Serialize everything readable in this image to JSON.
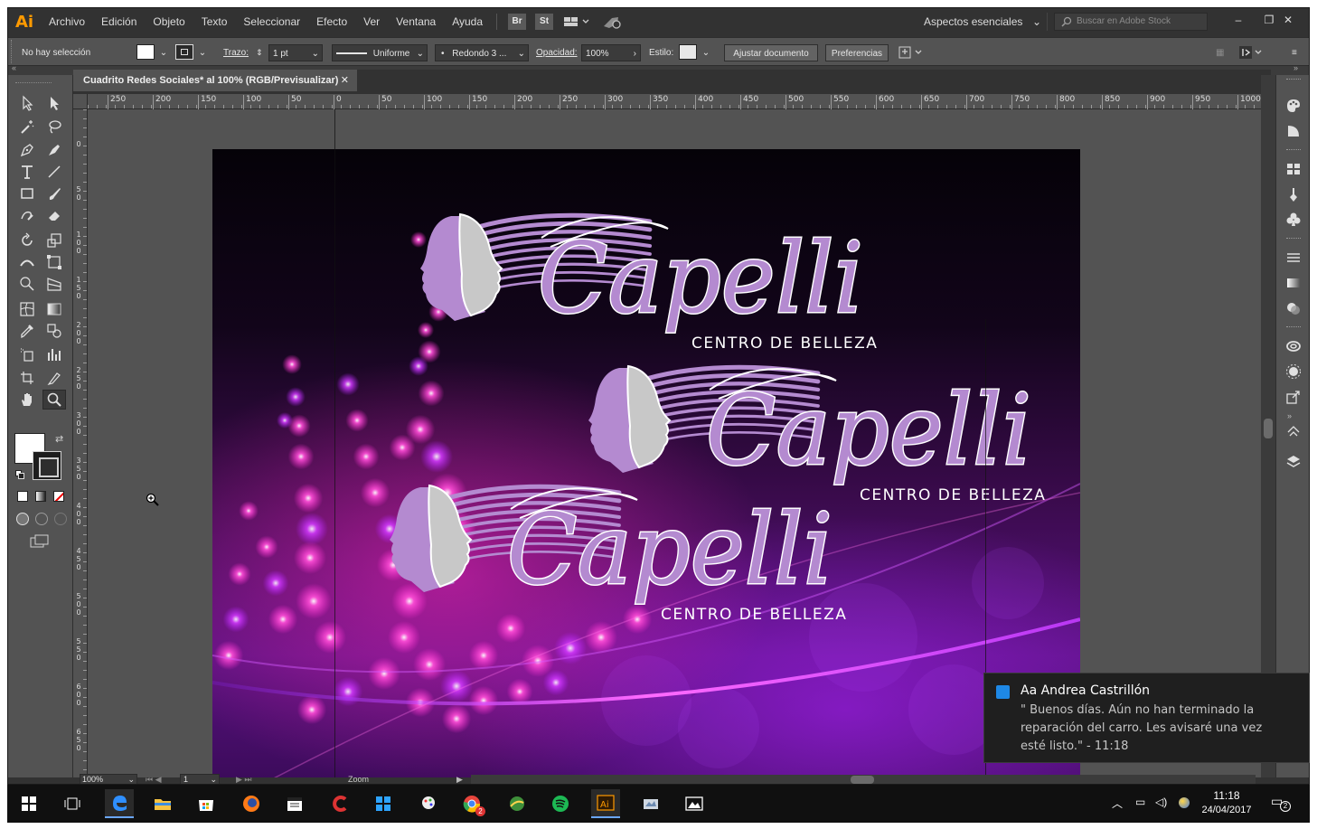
{
  "app": {
    "logo_text": "Ai",
    "menu": [
      "Archivo",
      "Edición",
      "Objeto",
      "Texto",
      "Seleccionar",
      "Efecto",
      "Ver",
      "Ventana",
      "Ayuda"
    ],
    "bridge_label": "Br",
    "stock_label": "St",
    "workspace": "Aspectos esenciales",
    "stock_search_placeholder": "Buscar en Adobe Stock",
    "window_controls": [
      "–",
      "❐",
      "✕"
    ]
  },
  "control_bar": {
    "selection_status": "No hay selección",
    "stroke_label": "Trazo:",
    "stroke_weight": "1 pt",
    "stroke_profile": "Uniforme",
    "brush_label": "Redondo 3 ...",
    "opacity_label": "Opacidad:",
    "opacity_value": "100%",
    "style_label": "Estilo:",
    "fit_button": "Ajustar documento",
    "prefs_button": "Preferencias"
  },
  "document": {
    "tab_title": "Cuadrito Redes Sociales* al 100% (RGB/Previsualizar)",
    "close_glyph": "✕"
  },
  "rulers": {
    "h_labels": [
      "250",
      "200",
      "150",
      "100",
      "50",
      "0",
      "50",
      "100",
      "150",
      "200",
      "250",
      "300",
      "350",
      "400",
      "450",
      "500",
      "550",
      "600",
      "650",
      "700",
      "750",
      "800",
      "850",
      "900",
      "950",
      "1000"
    ],
    "v_labels": [
      "0",
      "50",
      "100",
      "150",
      "200",
      "250",
      "300",
      "350",
      "400",
      "450",
      "500",
      "550",
      "600",
      "650"
    ]
  },
  "artwork": {
    "logo_title": "Capelli",
    "logo_subtitle": "CENTRO DE BELLEZA"
  },
  "status": {
    "zoom": "100%",
    "artboard_number": "1",
    "current_tool": "Zoom"
  },
  "notification": {
    "sender": "Aa Andrea Castrillón",
    "message": "\"                  Buenos días. Aún no han terminado la reparación del carro. Les avisaré una vez esté listo.\" - 11:18"
  },
  "taskbar": {
    "apps": [
      "windows-start",
      "task-view",
      "edge",
      "file-explorer",
      "store",
      "firefox",
      "calendar",
      "ccleaner",
      "windows-app",
      "paint",
      "chrome",
      "camera",
      "spotify",
      "illustrator",
      "scanner",
      "photos"
    ],
    "chrome_badge": "2",
    "clock_time": "11:18",
    "clock_date": "24/04/2017",
    "notification_count": "2"
  },
  "colors": {
    "ui_dark": "#323232",
    "ui_panel": "#535353",
    "accent_ai": "#ff9a00",
    "logo_purple": "#b48ad0",
    "logo_grey": "#c8c8c8"
  }
}
